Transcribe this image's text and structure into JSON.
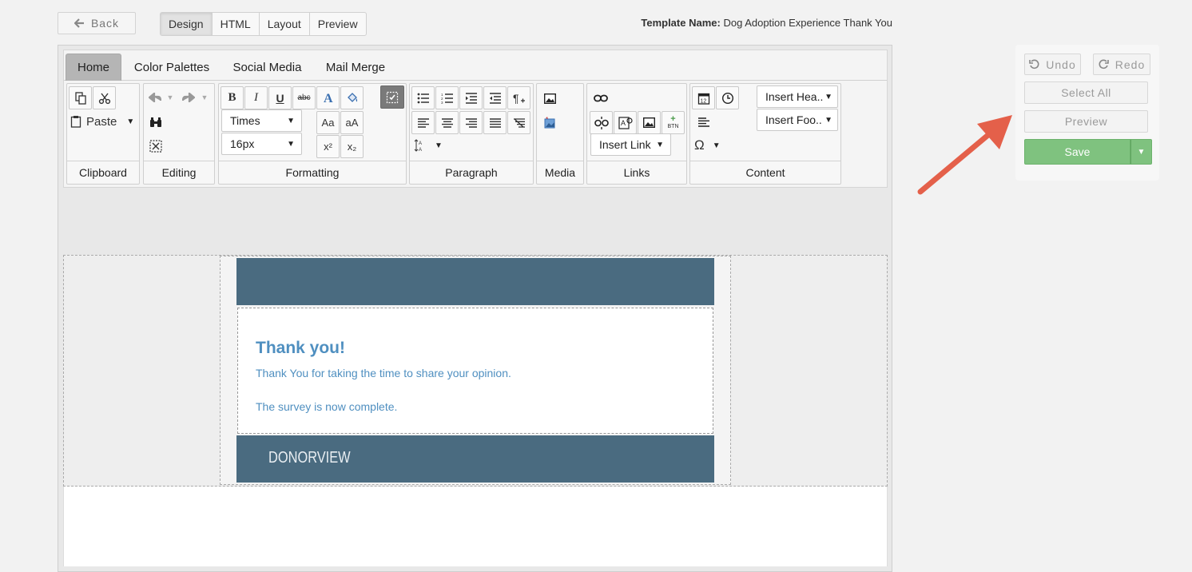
{
  "topbar": {
    "back_label": "Back",
    "modes": [
      "Design",
      "HTML",
      "Layout",
      "Preview"
    ],
    "active_mode": "Design",
    "template_label": "Template Name:",
    "template_name": "Dog Adoption Experience Thank You"
  },
  "ribbon": {
    "tabs": [
      "Home",
      "Color Palettes",
      "Social Media",
      "Mail Merge"
    ],
    "active_tab": "Home",
    "groups": {
      "clipboard": {
        "label": "Clipboard",
        "paste_label": "Paste"
      },
      "editing": {
        "label": "Editing"
      },
      "formatting": {
        "label": "Formatting",
        "bold": "B",
        "italic": "I",
        "underline": "U",
        "strike": "abc",
        "font": "Times",
        "size": "16px",
        "case_title": "Aa",
        "case_lower": "aA",
        "superscript": "x²",
        "subscript": "x₂"
      },
      "paragraph": {
        "label": "Paragraph"
      },
      "media": {
        "label": "Media"
      },
      "links": {
        "label": "Links",
        "insert_link": "Insert Link",
        "btn_badge": "BTN"
      },
      "content": {
        "label": "Content",
        "insert_header": "Insert Hea..",
        "insert_footer": "Insert Foo..",
        "calendar_day": "12",
        "omega": "Ω"
      }
    }
  },
  "email": {
    "title": "Thank you!",
    "line1": "Thank You for taking the time to share your opinion.",
    "line2": "The survey is now complete.",
    "footer_brand": "DONORVIEW"
  },
  "side_panel": {
    "undo": "Undo",
    "redo": "Redo",
    "select_all": "Select All",
    "preview": "Preview",
    "save": "Save"
  },
  "colors": {
    "email_band": "#4a6b80",
    "email_text": "#4f8fc0",
    "save_green": "#7fc27f",
    "arrow": "#e4604a"
  }
}
